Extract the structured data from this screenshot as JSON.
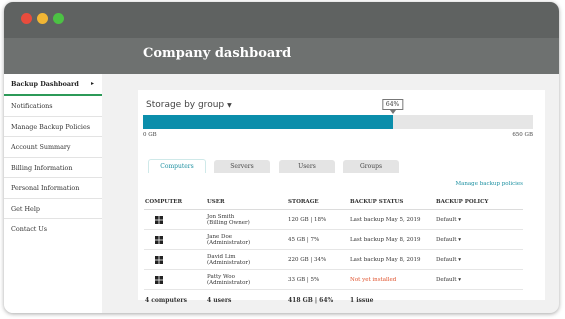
{
  "window": {
    "dots": [
      "#e84c3d",
      "#f1b634",
      "#4cc244"
    ]
  },
  "header": {
    "title": "Company dashboard"
  },
  "sidebar": {
    "items": [
      {
        "label": "Backup Dashboard",
        "active": true
      },
      {
        "label": "Notifications"
      },
      {
        "label": "Manage Backup Policies"
      },
      {
        "label": "Account Summary"
      },
      {
        "label": "Billing Information"
      },
      {
        "label": "Personal Information"
      },
      {
        "label": "Get Help"
      },
      {
        "label": "Contact Us"
      }
    ]
  },
  "storage": {
    "label": "Storage by group",
    "percent_label": "64%",
    "fill_fraction": 0.64,
    "min_label": "0 GB",
    "max_label": "650 GB",
    "fill_color": "#0b8eab"
  },
  "tabs": [
    "Computers",
    "Servers",
    "Users",
    "Groups"
  ],
  "manage_link": "Manage backup policies",
  "table": {
    "headers": [
      "COMPUTER",
      "USER",
      "STORAGE",
      "BACKUP STATUS",
      "BACKUP POLICY"
    ],
    "rows": [
      {
        "icon": "windows-icon",
        "user": "Jon Smith",
        "role": "(Billing Owner)",
        "storage": "120 GB | 18%",
        "status": "Last backup May 5, 2019",
        "policy": "Default"
      },
      {
        "icon": "windows-icon",
        "user": "Jane Doe",
        "role": "(Administrator)",
        "storage": "45 GB | 7%",
        "status": "Last backup May 8, 2019",
        "policy": "Default"
      },
      {
        "icon": "windows-icon",
        "user": "David Lim",
        "role": "(Administrator)",
        "storage": "220 GB | 34%",
        "status": "Last backup May 8, 2019",
        "policy": "Default"
      },
      {
        "icon": "windows-icon",
        "user": "Patty Woo",
        "role": "(Administrator)",
        "storage": "33 GB | 5%",
        "status": "Not yet installed",
        "policy": "Default",
        "status_warn": true
      }
    ],
    "footer": {
      "computers": "4 computers",
      "users": "4 users",
      "storage": "418 GB | 64%",
      "status": "1 issue"
    }
  }
}
